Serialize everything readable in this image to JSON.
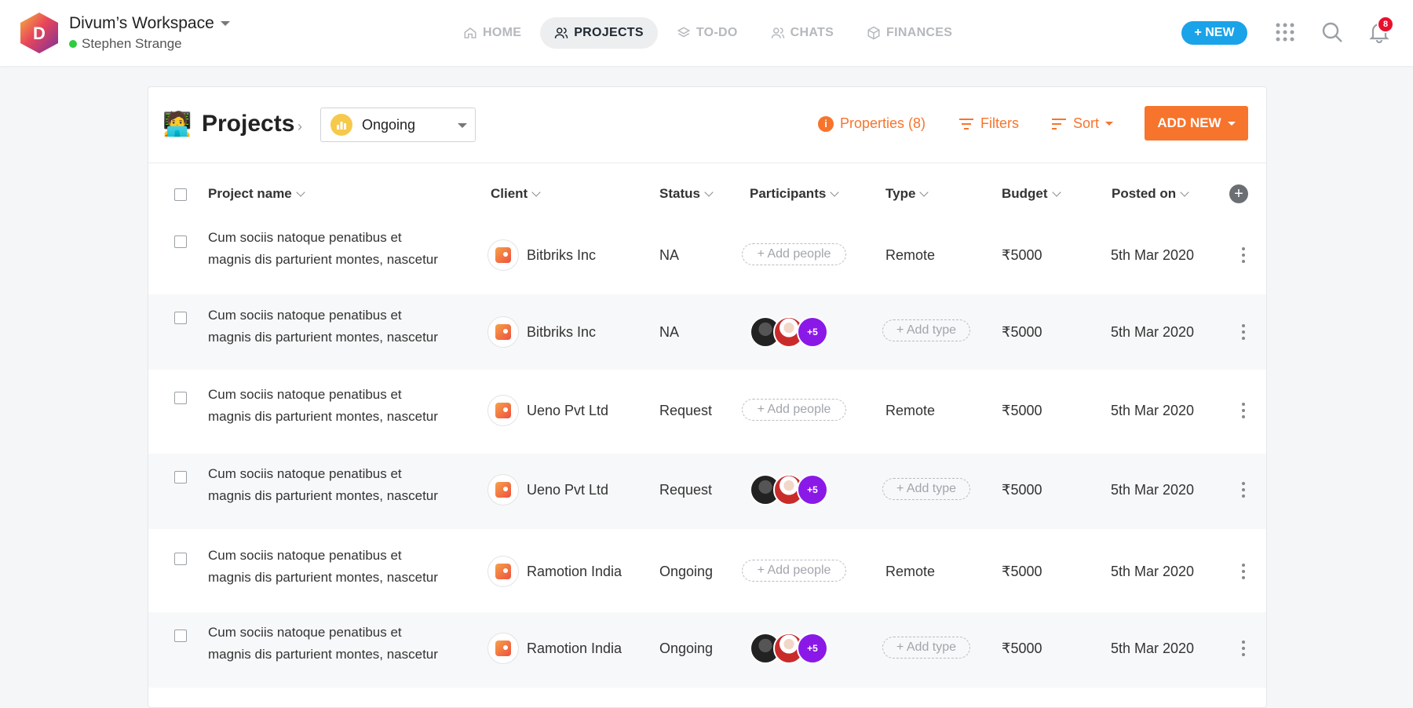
{
  "workspace": {
    "name": "Divum’s Workspace",
    "user": "Stephen Strange",
    "logo_letter": "D"
  },
  "nav": [
    {
      "label": "HOME",
      "icon": "home-icon",
      "active": false
    },
    {
      "label": "PROJECTS",
      "icon": "people-icon",
      "active": true
    },
    {
      "label": "TO-DO",
      "icon": "layers-icon",
      "active": false
    },
    {
      "label": "CHATS",
      "icon": "people-icon",
      "active": false
    },
    {
      "label": "FINANCES",
      "icon": "box-icon",
      "active": false
    }
  ],
  "topbar": {
    "new_label": "+ NEW",
    "notifications_count": "8"
  },
  "page": {
    "title": "Projects",
    "emoji": "🧑‍💻",
    "status_filter": "Ongoing",
    "properties": "Properties (8)",
    "filters": "Filters",
    "sort": "Sort",
    "add_new": "ADD NEW"
  },
  "table": {
    "columns": [
      "Project name",
      "Client",
      "Status",
      "Participants",
      "Type",
      "Budget",
      "Posted on"
    ],
    "rows": [
      {
        "name_line1": "Cum sociis natoque penatibus et",
        "name_line2": "magnis dis parturient montes, nascetur",
        "client": "Bitbriks Inc",
        "status": "NA",
        "participants": "+ Add people",
        "type": "Remote",
        "budget": "₹5000",
        "posted": "5th Mar 2020"
      },
      {
        "name_line1": "Cum sociis natoque penatibus et",
        "name_line2": "magnis dis parturient montes, nascetur",
        "client": "Bitbriks Inc",
        "status": "NA",
        "participants_more": "+5",
        "type": "+ Add type",
        "budget": "₹5000",
        "posted": "5th Mar 2020"
      },
      {
        "name_line1": "Cum sociis natoque penatibus et",
        "name_line2": "magnis dis parturient montes, nascetur",
        "client": "Ueno Pvt Ltd",
        "status": "Request",
        "participants": "+ Add people",
        "type": "Remote",
        "budget": "₹5000",
        "posted": "5th Mar 2020"
      },
      {
        "name_line1": "Cum sociis natoque penatibus et",
        "name_line2": "magnis dis parturient montes, nascetur",
        "client": "Ueno Pvt Ltd",
        "status": "Request",
        "participants_more": "+5",
        "type": "+ Add type",
        "budget": "₹5000",
        "posted": "5th Mar 2020"
      },
      {
        "name_line1": "Cum sociis natoque penatibus et",
        "name_line2": "magnis dis parturient montes, nascetur",
        "client": "Ramotion India",
        "status": "Ongoing",
        "participants": "+ Add people",
        "type": "Remote",
        "budget": "₹5000",
        "posted": "5th Mar 2020"
      },
      {
        "name_line1": "Cum sociis natoque penatibus et",
        "name_line2": "magnis dis parturient montes, nascetur",
        "client": "Ramotion India",
        "status": "Ongoing",
        "participants_more": "+5",
        "type": "+ Add type",
        "budget": "₹5000",
        "posted": "5th Mar 2020"
      }
    ]
  },
  "colors": {
    "accent_orange": "#f7742c",
    "new_blue": "#1aa3e8",
    "badge_red": "#e8112d",
    "avatar_purple": "#8a19e8"
  }
}
